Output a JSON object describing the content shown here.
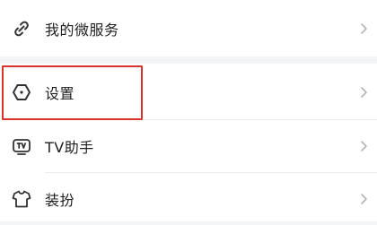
{
  "menu": {
    "items": [
      {
        "icon": "link-icon",
        "label": "我的微服务"
      },
      {
        "icon": "settings-hexagon-icon",
        "label": "设置"
      },
      {
        "icon": "tv-icon",
        "label": "TV助手"
      },
      {
        "icon": "tshirt-icon",
        "label": "装扮"
      }
    ]
  },
  "colors": {
    "highlight": "#d9342b",
    "background": "#f4f5f7",
    "text": "#1f1f1f",
    "chevron": "#b5b5b5"
  }
}
